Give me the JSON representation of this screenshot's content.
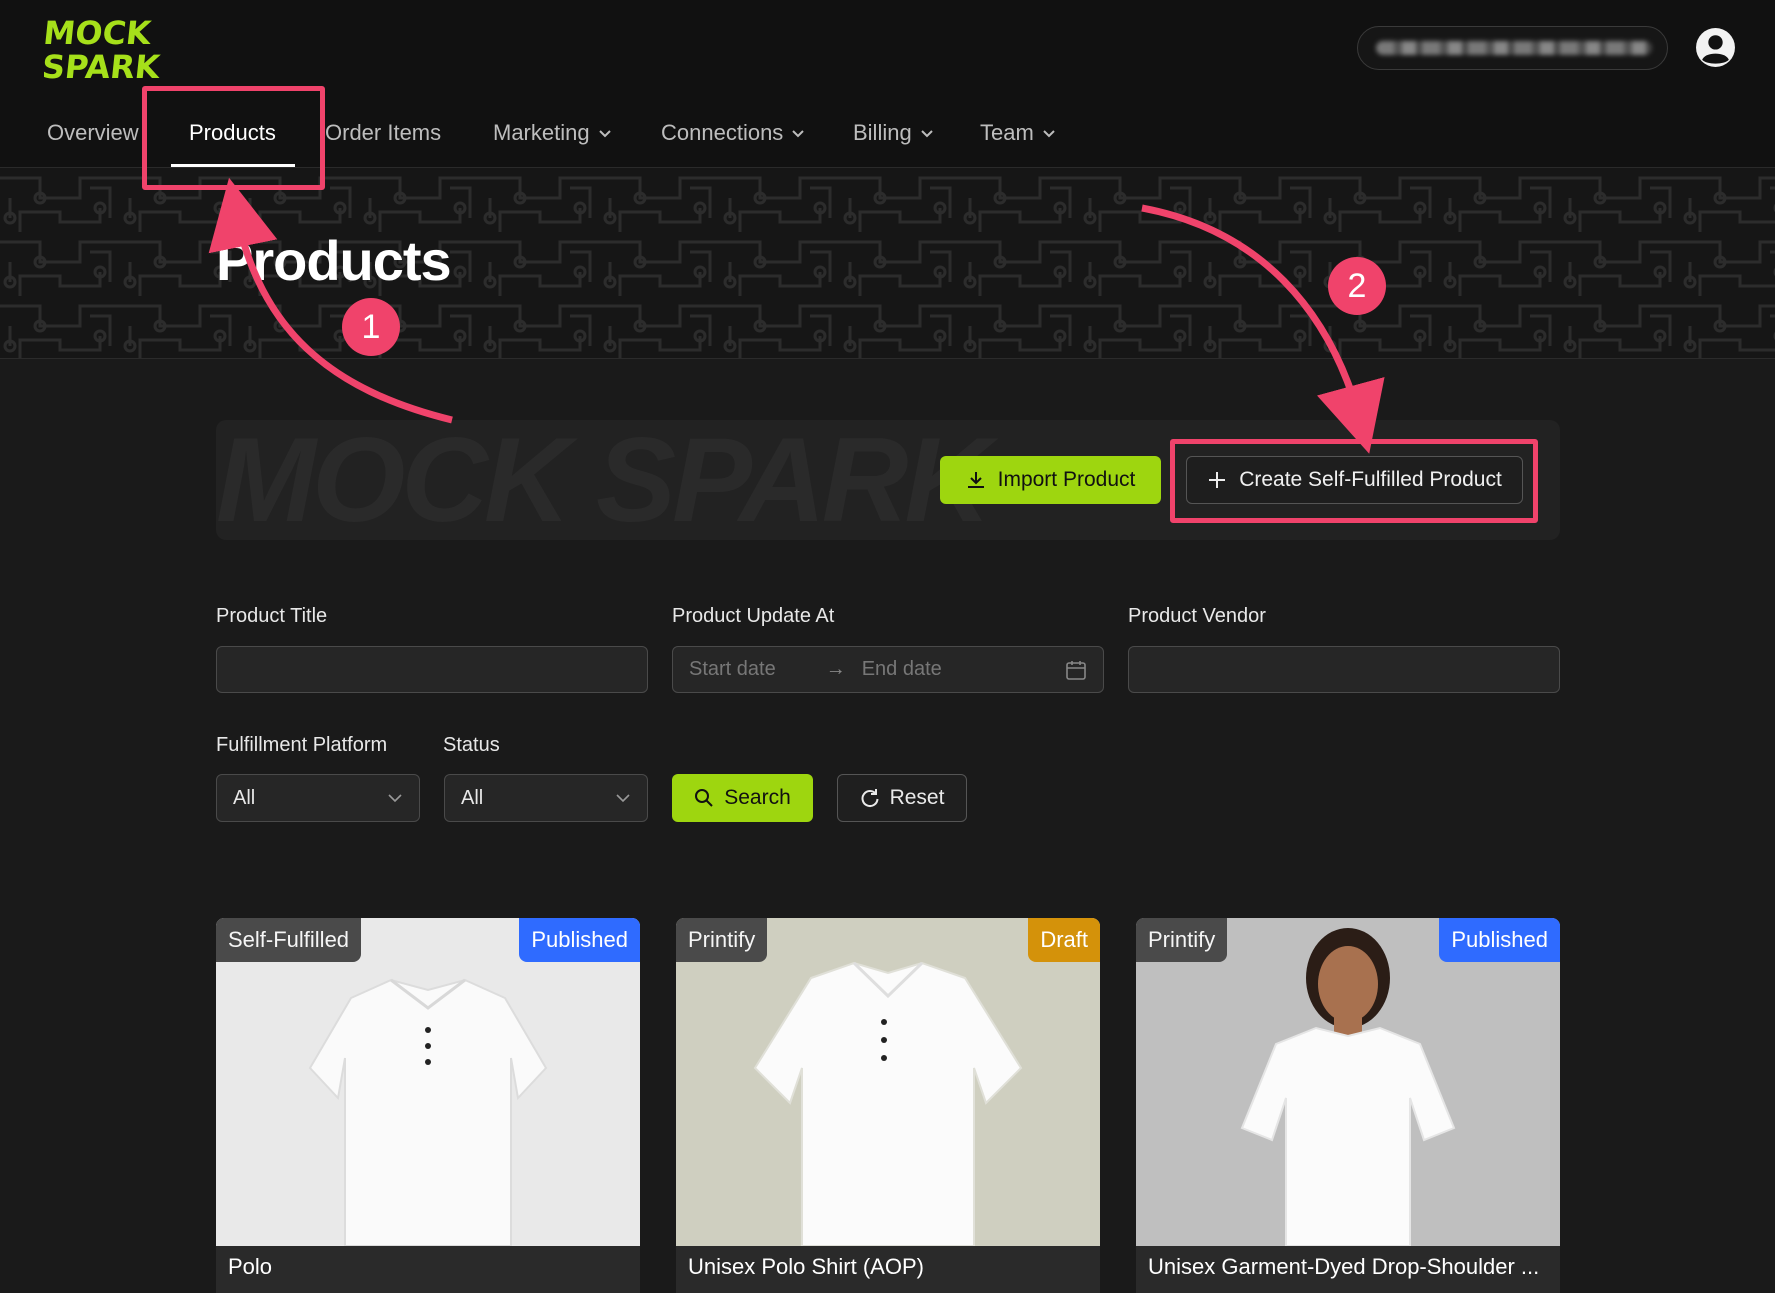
{
  "brand": {
    "logo_line1": "MOCK",
    "logo_line2": "SPARK",
    "accent": "#9ed60f"
  },
  "header": {
    "account_label": "",
    "user_icon": "user-circle-icon"
  },
  "nav": {
    "items": [
      {
        "label": "Overview",
        "dropdown": false
      },
      {
        "label": "Products",
        "dropdown": false,
        "active": true
      },
      {
        "label": "Order Items",
        "dropdown": false
      },
      {
        "label": "Marketing",
        "dropdown": true
      },
      {
        "label": "Connections",
        "dropdown": true
      },
      {
        "label": "Billing",
        "dropdown": true
      },
      {
        "label": "Team",
        "dropdown": true
      }
    ]
  },
  "page": {
    "title": "Products"
  },
  "actions": {
    "import_label": "Import Product",
    "create_label": "Create Self-Fulfilled Product",
    "watermark": "MOCK SPARK"
  },
  "filters": {
    "product_title_label": "Product Title",
    "product_title_value": "",
    "update_at_label": "Product Update At",
    "start_placeholder": "Start date",
    "end_placeholder": "End date",
    "vendor_label": "Product Vendor",
    "vendor_value": "",
    "platform_label": "Fulfillment Platform",
    "platform_value": "All",
    "status_label": "Status",
    "status_value": "All",
    "search_label": "Search",
    "reset_label": "Reset"
  },
  "products": [
    {
      "source": "Self-Fulfilled",
      "status": "Published",
      "status_color": "#2f6bff",
      "title": "Polo"
    },
    {
      "source": "Printify",
      "status": "Draft",
      "status_color": "#d4920a",
      "title": "Unisex Polo Shirt (AOP)"
    },
    {
      "source": "Printify",
      "status": "Published",
      "status_color": "#2f6bff",
      "title": "Unisex Garment-Dyed Drop-Shoulder ..."
    }
  ],
  "annotations": {
    "badge1": "1",
    "badge2": "2",
    "color": "#f0436b"
  }
}
